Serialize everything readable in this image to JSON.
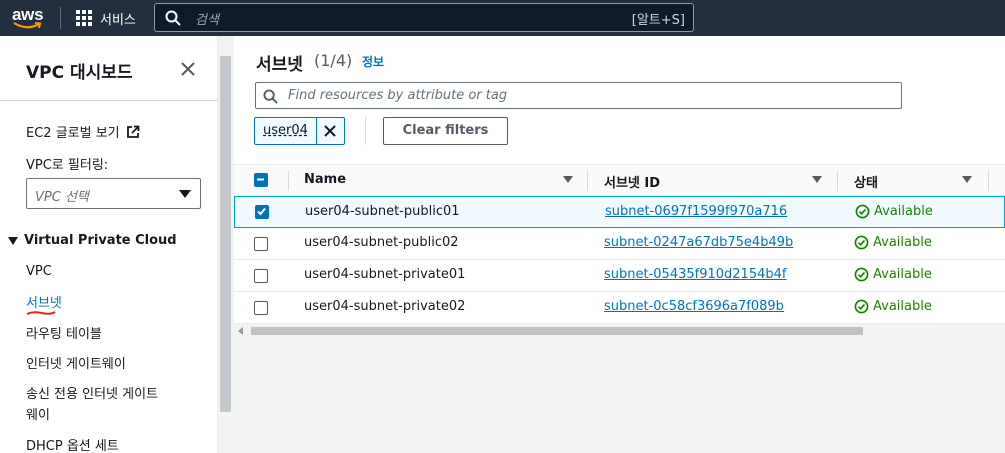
{
  "topnav": {
    "logo_text": "aws",
    "services_label": "서비스",
    "search_placeholder": "검색",
    "search_shortcut": "[알트+S]"
  },
  "sidebar": {
    "title": "VPC 대시보드",
    "ec2_global_view": "EC2 글로벌 보기",
    "filter_label": "VPC로 필터링:",
    "select_placeholder": "VPC 선택",
    "section_title": "Virtual Private Cloud",
    "items": [
      {
        "label": "VPC"
      },
      {
        "label": "서브넷"
      },
      {
        "label": "라우팅 테이블"
      },
      {
        "label": "인터넷 게이트웨이"
      },
      {
        "label": "송신 전용 인터넷 게이트"
      },
      {
        "label": "웨이"
      },
      {
        "label": "DHCP 옵션 세트"
      }
    ]
  },
  "main": {
    "title": "서브넷",
    "count": "(1/4)",
    "info_link": "정보",
    "filter_placeholder": "Find resources by attribute or tag",
    "token_label": "user04",
    "clear_filters": "Clear filters",
    "columns": [
      "Name",
      "서브넷 ID",
      "상태"
    ],
    "rows": [
      {
        "name": "user04-subnet-public01",
        "id": "subnet-0697f1599f970a716",
        "state": "Available",
        "selected": true
      },
      {
        "name": "user04-subnet-public02",
        "id": "subnet-0247a67db75e4b49b",
        "state": "Available",
        "selected": false
      },
      {
        "name": "user04-subnet-private01",
        "id": "subnet-05435f910d2154b4f",
        "state": "Available",
        "selected": false
      },
      {
        "name": "user04-subnet-private02",
        "id": "subnet-0c58cf3696a7f089b",
        "state": "Available",
        "selected": false
      }
    ]
  },
  "colors": {
    "nav_bg": "#232f3e",
    "link": "#0073bb",
    "success": "#1d8102",
    "annotation": "#d13212"
  }
}
